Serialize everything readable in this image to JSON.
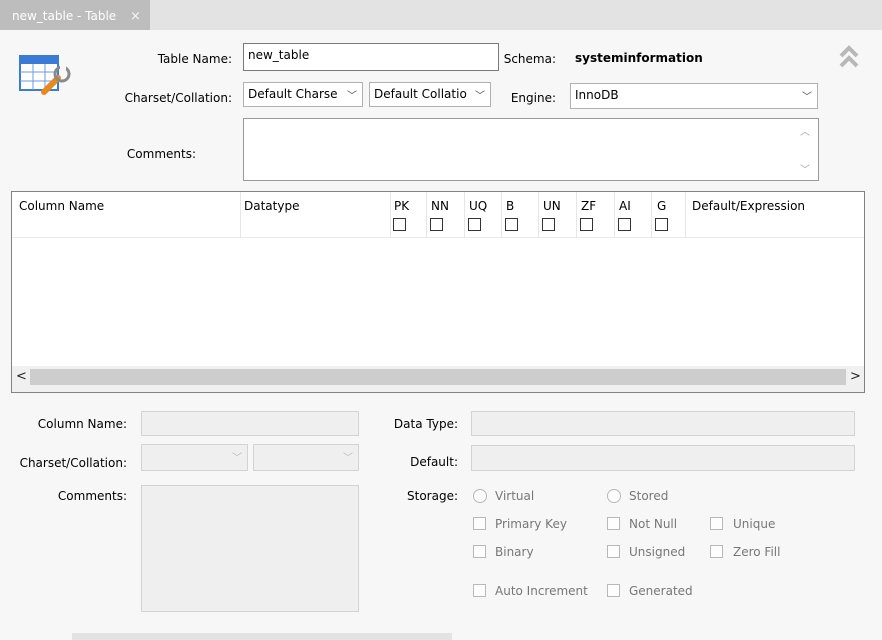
{
  "doc_tab": {
    "title": "new_table - Table",
    "close": "×"
  },
  "table": {
    "name_label": "Table Name:",
    "name_value": "new_table",
    "schema_label": "Schema:",
    "schema_value": "systeminformation",
    "charset_label": "Charset/Collation:",
    "charset_value": "Default Charse",
    "collation_value": "Default Collatio",
    "engine_label": "Engine:",
    "engine_value": "InnoDB",
    "comments_label": "Comments:"
  },
  "grid": {
    "headers": [
      "Column Name",
      "Datatype",
      "PK",
      "NN",
      "UQ",
      "B",
      "UN",
      "ZF",
      "AI",
      "G",
      "Default/Expression"
    ]
  },
  "detail": {
    "column_name_label": "Column Name:",
    "charset_label": "Charset/Collation:",
    "comments_label": "Comments:",
    "data_type_label": "Data Type:",
    "default_label": "Default:",
    "storage_label": "Storage:",
    "virtual": "Virtual",
    "stored": "Stored",
    "primary_key": "Primary Key",
    "not_null": "Not Null",
    "unique": "Unique",
    "binary": "Binary",
    "unsigned": "Unsigned",
    "zero_fill": "Zero Fill",
    "auto_increment": "Auto Increment",
    "generated": "Generated"
  },
  "icons": {
    "table_icon": "table-editor-icon",
    "collapse": "double-chevron-up-icon",
    "dropdown": "chevron-down-icon"
  }
}
